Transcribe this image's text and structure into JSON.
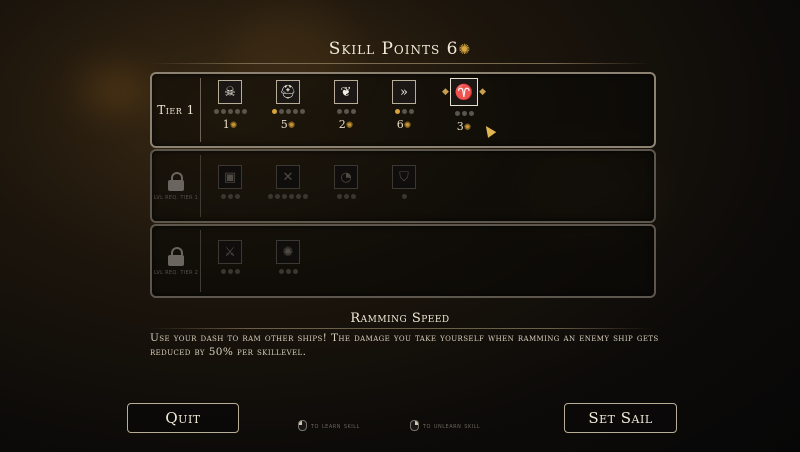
{
  "header": {
    "title": "Skill Points",
    "points": "6",
    "currency_icon": "gear-icon"
  },
  "tiers": [
    {
      "label": "Tier 1",
      "locked": false,
      "skills": [
        {
          "icon": "skull-helmet-icon",
          "glyph": "☠",
          "max_level": 5,
          "level": 0,
          "cost": "1"
        },
        {
          "icon": "shield-helmet-icon",
          "glyph": "⛑",
          "max_level": 5,
          "level": 1,
          "cost": "5"
        },
        {
          "icon": "claw-icon",
          "glyph": "❦",
          "max_level": 3,
          "level": 0,
          "cost": "2"
        },
        {
          "icon": "dash-arrows-icon",
          "glyph": "»",
          "max_level": 3,
          "level": 1,
          "cost": "6"
        },
        {
          "icon": "ram-icon",
          "glyph": "♈",
          "max_level": 3,
          "level": 0,
          "cost": "3",
          "selected": true
        }
      ]
    },
    {
      "label": "Locked",
      "locked": true,
      "lock_caption": "LVL REQ. TIER 1",
      "skills": [
        {
          "icon": "cannon-crate-icon",
          "glyph": "▣",
          "max_level": 3
        },
        {
          "icon": "crossed-tools-icon",
          "glyph": "✕",
          "max_level": 6
        },
        {
          "icon": "swirl-icon",
          "glyph": "◔",
          "max_level": 3
        },
        {
          "icon": "shield-icon",
          "glyph": "⛉",
          "max_level": 1
        }
      ]
    },
    {
      "label": "Locked",
      "locked": true,
      "lock_caption": "LVL REQ. TIER 2",
      "skills": [
        {
          "icon": "crossed-swords-icon",
          "glyph": "⚔",
          "max_level": 3
        },
        {
          "icon": "compass-icon",
          "glyph": "✺",
          "max_level": 3
        }
      ]
    }
  ],
  "selected_skill": {
    "name": "Ramming Speed",
    "description": "Use your dash to ram other ships! The damage you take yourself when ramming an enemy ship gets reduced by 50% per skillevel."
  },
  "footer": {
    "quit_label": "Quit",
    "set_sail_label": "Set Sail",
    "learn_hint": "to learn skill",
    "unlearn_hint": "to unlearn skill"
  },
  "colors": {
    "accent_gold": "#d7a43c",
    "frame": "#8c8272",
    "text": "#f2ead8"
  }
}
